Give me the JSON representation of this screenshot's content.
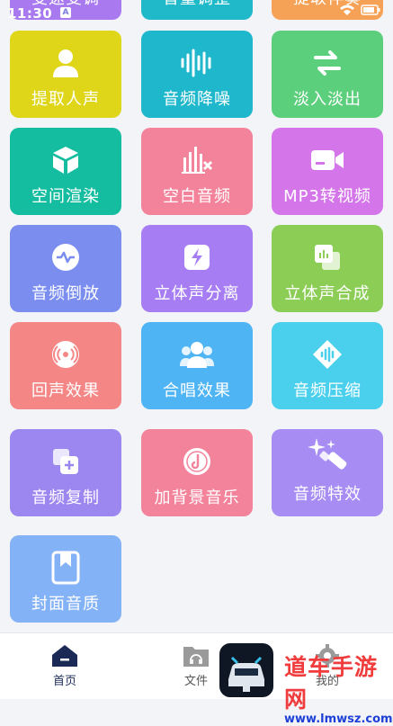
{
  "status_bar": {
    "time": "11:30",
    "notif_icon": "A"
  },
  "top_row": [
    {
      "label": "变速变调",
      "color": "#a979f0"
    },
    {
      "label": "音量调整",
      "color": "#20b9c9"
    },
    {
      "label": "提取伴奏",
      "color": "#f6a256"
    }
  ],
  "tiles": [
    {
      "label": "提取人声",
      "color": "#dfd61a",
      "icon": "person-icon"
    },
    {
      "label": "音频降噪",
      "color": "#1fb7cc",
      "icon": "waveform-icon"
    },
    {
      "label": "淡入淡出",
      "color": "#5ccf7c",
      "icon": "swap-arrows-icon"
    },
    {
      "label": "空间渲染",
      "color": "#15bda0",
      "icon": "cube-icon"
    },
    {
      "label": "空白音频",
      "color": "#f3839b",
      "icon": "bars-mute-icon"
    },
    {
      "label": "MP3转视频",
      "color": "#d575ea",
      "icon": "video-camera-icon"
    },
    {
      "label": "音频倒放",
      "color": "#7b8ef0",
      "icon": "pulse-icon"
    },
    {
      "label": "立体声分离",
      "color": "#a67df2",
      "icon": "bolt-icon"
    },
    {
      "label": "立体声合成",
      "color": "#8ccd56",
      "icon": "merge-icon"
    },
    {
      "label": "回声效果",
      "color": "#f58686",
      "icon": "broadcast-icon"
    },
    {
      "label": "合唱效果",
      "color": "#4fb4f3",
      "icon": "group-icon"
    },
    {
      "label": "音频压缩",
      "color": "#4ad0ec",
      "icon": "compress-icon"
    },
    {
      "label": "音频复制",
      "color": "#9c86f0",
      "icon": "copy-icon"
    },
    {
      "label": "加背景音乐",
      "color": "#f3839b",
      "icon": "music-disc-icon"
    },
    {
      "label": "音频特效",
      "color": "#a68cf3",
      "icon": "magic-wand-icon"
    },
    {
      "label": "封面音质",
      "color": "#84b2f6",
      "icon": "bookmark-icon"
    }
  ],
  "tabbar": [
    {
      "label": "首页",
      "icon": "home-icon",
      "active": true
    },
    {
      "label": "文件",
      "icon": "folder-icon",
      "active": false
    },
    {
      "label": "我的",
      "icon": "gear-icon",
      "active": false
    }
  ],
  "watermark": {
    "title": "道车手游网",
    "url": "www.lmwsz.com"
  }
}
